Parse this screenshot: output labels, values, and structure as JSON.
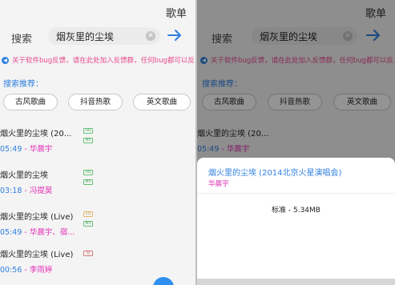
{
  "header": {
    "songlist_label": "歌单"
  },
  "search": {
    "label": "搜索",
    "value": "烟灰里的尘埃"
  },
  "notice": {
    "text": "关于软件bug反馈，请在此处加入反馈群，任何bug都可以反..."
  },
  "recommend": {
    "title": "搜索推荐：",
    "chips": [
      "古风歌曲",
      "抖音热歌",
      "英文歌曲"
    ]
  },
  "results": [
    {
      "title": "烟火里的尘埃 (20...",
      "duration": "05:49",
      "artist": "华晨宇",
      "badges": [
        "HQ",
        "MV"
      ]
    },
    {
      "title": "烟火里的尘埃",
      "duration": "03:18",
      "artist": "冯提莫",
      "badges": [
        "HQ",
        "MV"
      ]
    },
    {
      "title": "烟火里的尘埃 (Live)",
      "duration": "05:49",
      "artist": "华晨宇、宿...",
      "badges": [
        "SQ",
        "MV"
      ]
    },
    {
      "title": "烟火里的尘埃 (Live)",
      "duration": "00:56",
      "artist": "李雨婷",
      "badges": [
        "包"
      ]
    }
  ],
  "sheet": {
    "song_title": "烟火里的尘埃 (2014北京火星演唱会)",
    "artist": "华晨宇",
    "quality_option": "标准 - 5.34MB"
  },
  "colors": {
    "accent": "#2f7fe0",
    "artist": "#e32db6",
    "notice": "#e84a8c"
  }
}
